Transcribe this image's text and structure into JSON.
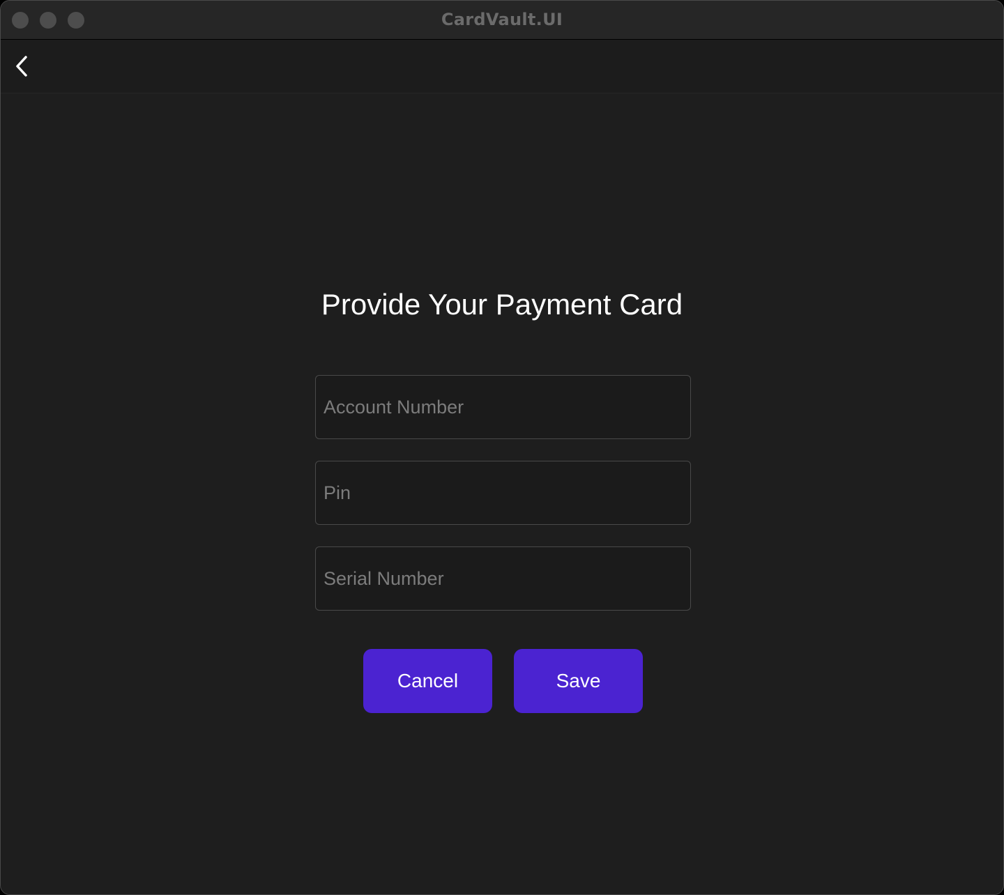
{
  "window": {
    "title": "CardVault.UI"
  },
  "navbar": {
    "back_icon": "chevron-left-icon"
  },
  "form": {
    "title": "Provide Your Payment Card",
    "fields": [
      {
        "placeholder": "Account Number",
        "value": ""
      },
      {
        "placeholder": "Pin",
        "value": ""
      },
      {
        "placeholder": "Serial Number",
        "value": ""
      }
    ],
    "cancel_label": "Cancel",
    "save_label": "Save"
  },
  "colors": {
    "accent": "#4b23d1",
    "background": "#1e1e1e",
    "text": "#ffffff",
    "placeholder": "#7c7c7c"
  }
}
